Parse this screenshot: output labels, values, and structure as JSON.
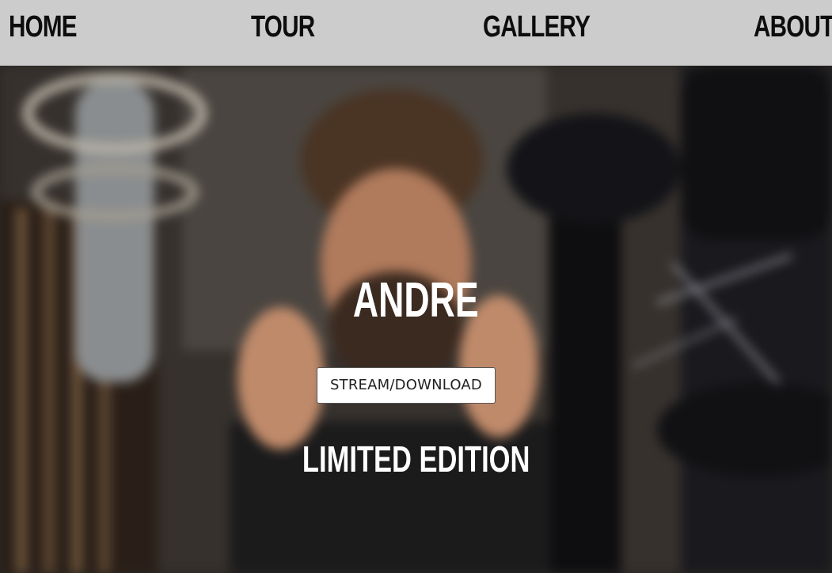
{
  "nav": {
    "items": [
      {
        "label": "HOME"
      },
      {
        "label": "TOUR"
      },
      {
        "label": "GALLERY"
      },
      {
        "label": "ABOUT"
      }
    ]
  },
  "hero": {
    "title": "ANDRE",
    "button_label": "STREAM/DOWNLOAD",
    "subtitle": "LIMITED EDITION"
  },
  "colors": {
    "nav_background": "#cccccc",
    "nav_text": "#0d0d0d",
    "hero_text": "#ffffff",
    "button_background": "#ffffff"
  }
}
